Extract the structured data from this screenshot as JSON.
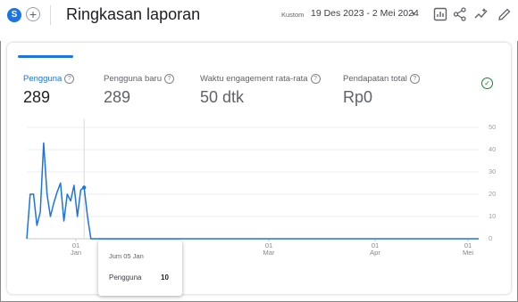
{
  "header": {
    "segment_initial": "S",
    "add_segment": "+",
    "title": "Ringkasan laporan",
    "date_label": "Kustom",
    "date_range": "19 Des 2023 - 2 Mei 2024",
    "date_caret": "▾"
  },
  "metrics": [
    {
      "label": "Pengguna",
      "value": "289",
      "active": true
    },
    {
      "label": "Pengguna baru",
      "value": "289"
    },
    {
      "label": "Waktu engagement rata-rata",
      "value": "50 dtk"
    },
    {
      "label": "Pendapatan total",
      "value": "Rp0"
    }
  ],
  "help_glyph": "?",
  "status_glyph": "✓",
  "chart_data": {
    "type": "line",
    "ylim": [
      0,
      50
    ],
    "y_ticks": [
      "50",
      "40",
      "30",
      "20",
      "10",
      "0"
    ],
    "x_ticks": [
      {
        "day": "01",
        "month": "Jan"
      },
      {
        "day": "01",
        "month": "Mar"
      },
      {
        "day": "01",
        "month": "Apr"
      },
      {
        "day": "01",
        "month": "Mei"
      }
    ],
    "series": [
      {
        "color": "#1a73e8",
        "values": [
          0,
          20,
          20,
          6,
          12,
          43,
          20,
          10,
          16,
          21,
          25,
          8,
          20,
          17,
          24,
          10,
          22,
          23,
          10,
          0,
          0,
          0,
          0,
          0,
          0,
          0,
          0,
          0,
          0,
          0,
          0,
          0,
          0,
          0,
          0,
          0,
          0,
          0,
          0,
          0,
          0,
          0,
          0,
          0,
          0,
          0,
          0,
          0,
          0,
          0,
          0,
          0,
          0,
          0,
          0,
          0,
          0,
          0,
          0,
          0,
          0,
          0,
          0,
          0,
          0,
          0,
          0,
          0,
          0,
          0,
          0,
          0,
          0,
          0,
          0,
          0,
          0,
          0,
          0,
          0,
          0,
          0,
          0,
          0,
          0,
          0,
          0,
          0,
          0,
          0,
          0,
          0,
          0,
          0,
          0,
          0,
          0,
          0,
          0,
          0,
          0,
          0,
          0,
          0,
          0,
          0,
          0,
          0,
          0,
          0,
          0,
          0,
          0,
          0,
          0,
          0,
          0,
          0,
          0,
          0,
          0,
          0,
          0,
          0,
          0,
          0,
          0,
          0,
          0,
          0,
          0,
          0,
          0,
          0,
          0
        ]
      }
    ],
    "highlight_index": 17
  },
  "tooltip": {
    "date": "Jum 05 Jan",
    "metric": "Pengguna",
    "value": "10"
  },
  "icons": [
    "customize-report-icon",
    "share-icon",
    "insights-icon",
    "edit-icon"
  ]
}
